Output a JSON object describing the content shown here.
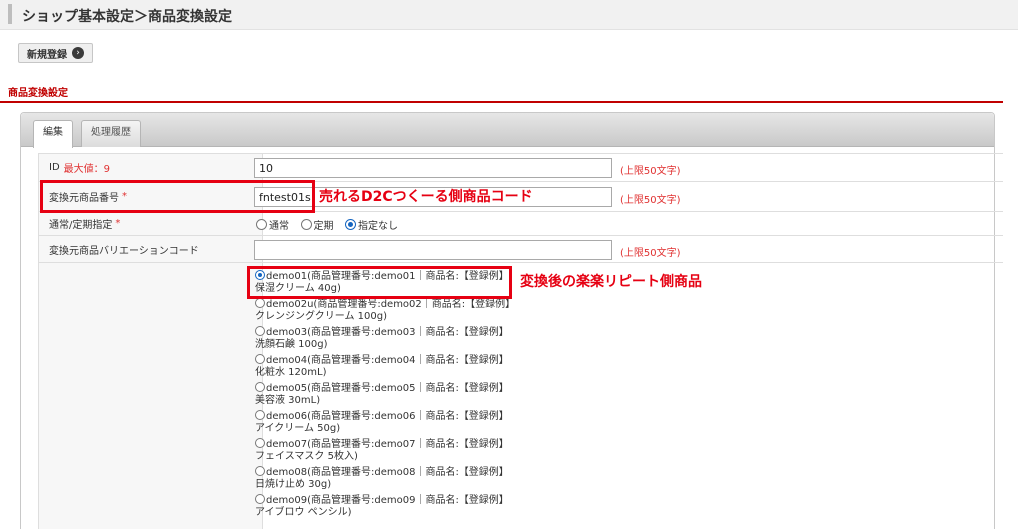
{
  "header": {
    "title": "ショップ基本設定＞商品変換設定"
  },
  "toolbar": {
    "new_label": "新規登録"
  },
  "section": {
    "title": "商品変換設定"
  },
  "tabs": [
    {
      "label": "編集",
      "active": true
    },
    {
      "label": "処理履歴",
      "active": false
    }
  ],
  "form": {
    "id": {
      "label": "ID",
      "max_label": "最大値：9",
      "value": "10",
      "limit": "(上限50文字)"
    },
    "source_code": {
      "label": "変換元商品番号",
      "required": "*",
      "value": "fntest01s",
      "limit": "(上限50文字)"
    },
    "type": {
      "label": "通常/定期指定",
      "required": "*",
      "options": [
        "通常",
        "定期",
        "指定なし"
      ],
      "selected": "指定なし"
    },
    "variation": {
      "label": "変換元商品バリエーションコード",
      "value": "",
      "limit": "(上限50文字)"
    },
    "products": [
      {
        "line1": "demo01(商品管理番号:demo01｜商品名:【登録例】",
        "line2": "保湿クリーム 40g)",
        "selected": true
      },
      {
        "line1": "demo02u(商品管理番号:demo02｜商品名:【登録例】",
        "line2": "クレンジングクリーム 100g)",
        "selected": false
      },
      {
        "line1": "demo03(商品管理番号:demo03｜商品名:【登録例】",
        "line2": "洗顔石鹸 100g)",
        "selected": false
      },
      {
        "line1": "demo04(商品管理番号:demo04｜商品名:【登録例】",
        "line2": "化粧水 120mL)",
        "selected": false
      },
      {
        "line1": "demo05(商品管理番号:demo05｜商品名:【登録例】",
        "line2": "美容液 30mL)",
        "selected": false
      },
      {
        "line1": "demo06(商品管理番号:demo06｜商品名:【登録例】",
        "line2": "アイクリーム 50g)",
        "selected": false
      },
      {
        "line1": "demo07(商品管理番号:demo07｜商品名:【登録例】",
        "line2": "フェイスマスク 5枚入)",
        "selected": false
      },
      {
        "line1": "demo08(商品管理番号:demo08｜商品名:【登録例】",
        "line2": "日焼け止め 30g)",
        "selected": false
      },
      {
        "line1": "demo09(商品管理番号:demo09｜商品名:【登録例】",
        "line2": "アイブロウ ペンシル)",
        "selected": false
      }
    ]
  },
  "annotations": {
    "source_code_note": "売れるD2Cつくーる側商品コード",
    "product_note": "変換後の楽楽リピート側商品"
  },
  "colors": {
    "accent": "#c00000",
    "highlight": "#e60012",
    "radio_selected": "#1565c0"
  }
}
